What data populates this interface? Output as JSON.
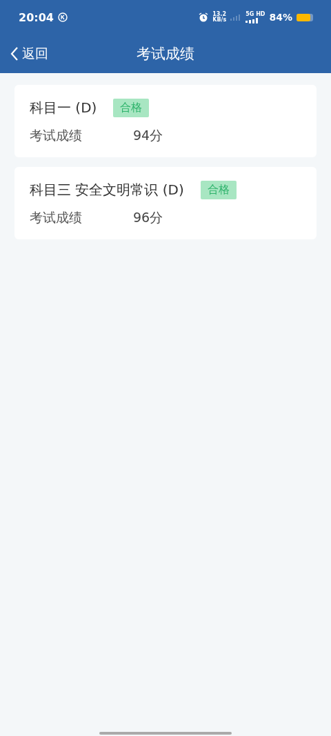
{
  "status_bar": {
    "time": "20:04",
    "speed": "13.2",
    "speed_unit": "KB/s",
    "network": "5G HD",
    "battery": "84%"
  },
  "nav": {
    "back": "返回",
    "title": "考试成绩"
  },
  "results": [
    {
      "subject": "科目一 (D)",
      "status": "合格",
      "label": "考试成绩",
      "score": "94分"
    },
    {
      "subject": "科目三 安全文明常识 (D)",
      "status": "合格",
      "label": "考试成绩",
      "score": "96分"
    }
  ]
}
